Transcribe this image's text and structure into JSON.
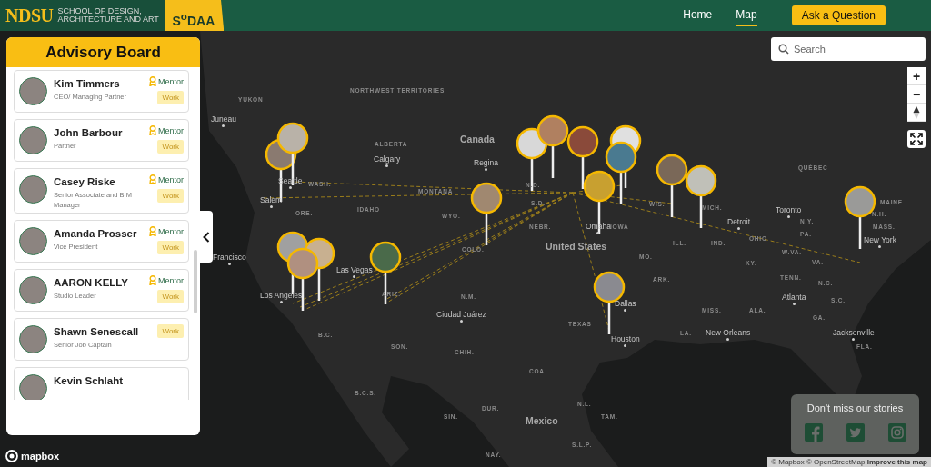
{
  "header": {
    "logo_mark": "NDSU",
    "school_name": "SCHOOL OF DESIGN, ARCHITECTURE AND ART",
    "badge": "S$^{o}$DAA",
    "nav": [
      {
        "label": "Home",
        "selected": false
      },
      {
        "label": "Map",
        "selected": true
      }
    ],
    "cta": "Ask a Question"
  },
  "panel": {
    "title": "Advisory Board",
    "members": [
      {
        "name": "Kim Timmers",
        "role": "CEO/ Managing Partner",
        "mentor": true,
        "mentor_label": "Mentor",
        "tag": "Work"
      },
      {
        "name": "John Barbour",
        "role": "Partner",
        "mentor": true,
        "mentor_label": "Mentor",
        "tag": "Work"
      },
      {
        "name": "Casey Riske",
        "role": "Senior Associate and BIM Manager",
        "mentor": true,
        "mentor_label": "Mentor",
        "tag": "Work"
      },
      {
        "name": "Amanda Prosser",
        "role": "Vice President",
        "mentor": true,
        "mentor_label": "Mentor",
        "tag": "Work"
      },
      {
        "name": "AARON KELLY",
        "role": "Studio Leader",
        "mentor": true,
        "mentor_label": "Mentor",
        "tag": "Work"
      },
      {
        "name": "Shawn Senescall",
        "role": "Senior Job Captain",
        "mentor": false,
        "tag": "Work"
      },
      {
        "name": "Kevin Schlaht",
        "mentor": false
      }
    ]
  },
  "search": {
    "placeholder": "Search"
  },
  "zoom_controls": [
    "+",
    "−"
  ],
  "map_labels": [
    {
      "text": "NORTHWEST TERRITORIES",
      "kind": "region"
    },
    {
      "text": "YUKON",
      "kind": "region"
    },
    {
      "text": "Juneau",
      "kind": "city"
    },
    {
      "text": "Canada",
      "kind": "country"
    },
    {
      "text": "ALBERTA",
      "kind": "region"
    },
    {
      "text": "Calgary",
      "kind": "city"
    },
    {
      "text": "Regina",
      "kind": "city"
    },
    {
      "text": "QUÉBEC",
      "kind": "region"
    },
    {
      "text": "Seattle",
      "kind": "city"
    },
    {
      "text": "WASH.",
      "kind": "region"
    },
    {
      "text": "MONTANA",
      "kind": "region"
    },
    {
      "text": "N.D.",
      "kind": "region"
    },
    {
      "text": "Salem",
      "kind": "city"
    },
    {
      "text": "S.D.",
      "kind": "region"
    },
    {
      "text": "IDAHO",
      "kind": "region"
    },
    {
      "text": "ORE.",
      "kind": "region"
    },
    {
      "text": "WYO.",
      "kind": "region"
    },
    {
      "text": "MICH.",
      "kind": "region"
    },
    {
      "text": "Toronto",
      "kind": "city"
    },
    {
      "text": "MAINE",
      "kind": "region"
    },
    {
      "text": "WIS.",
      "kind": "region"
    },
    {
      "text": "Detroit",
      "kind": "city"
    },
    {
      "text": "N.H.",
      "kind": "region"
    },
    {
      "text": "N.Y.",
      "kind": "region"
    },
    {
      "text": "NEBR.",
      "kind": "region"
    },
    {
      "text": "Omaha",
      "kind": "city"
    },
    {
      "text": "IOWA",
      "kind": "region"
    },
    {
      "text": "MASS.",
      "kind": "region"
    },
    {
      "text": "PA.",
      "kind": "region"
    },
    {
      "text": "OHIO",
      "kind": "region"
    },
    {
      "text": "New York",
      "kind": "city"
    },
    {
      "text": "ILL.",
      "kind": "region"
    },
    {
      "text": "IND.",
      "kind": "region"
    },
    {
      "text": "United States",
      "kind": "country"
    },
    {
      "text": "COLO.",
      "kind": "region"
    },
    {
      "text": "Francisco",
      "kind": "city"
    },
    {
      "text": "W.VA.",
      "kind": "region"
    },
    {
      "text": "MO.",
      "kind": "region"
    },
    {
      "text": "KY.",
      "kind": "region"
    },
    {
      "text": "VA.",
      "kind": "region"
    },
    {
      "text": "Las Vegas",
      "kind": "city"
    },
    {
      "text": "TENN.",
      "kind": "region"
    },
    {
      "text": "ARK.",
      "kind": "region"
    },
    {
      "text": "N.C.",
      "kind": "region"
    },
    {
      "text": "Los Angeles",
      "kind": "city"
    },
    {
      "text": "ARIZ.",
      "kind": "region"
    },
    {
      "text": "N.M.",
      "kind": "region"
    },
    {
      "text": "Atlanta",
      "kind": "city"
    },
    {
      "text": "S.C.",
      "kind": "region"
    },
    {
      "text": "Dallas",
      "kind": "city"
    },
    {
      "text": "Ciudad Juárez",
      "kind": "city"
    },
    {
      "text": "MISS.",
      "kind": "region"
    },
    {
      "text": "ALA.",
      "kind": "region"
    },
    {
      "text": "GA.",
      "kind": "region"
    },
    {
      "text": "TEXAS",
      "kind": "region"
    },
    {
      "text": "LA.",
      "kind": "region"
    },
    {
      "text": "New Orleans",
      "kind": "city"
    },
    {
      "text": "Jacksonville",
      "kind": "city"
    },
    {
      "text": "B.C.",
      "kind": "region"
    },
    {
      "text": "Houston",
      "kind": "city"
    },
    {
      "text": "SON.",
      "kind": "region"
    },
    {
      "text": "FLA.",
      "kind": "region"
    },
    {
      "text": "CHIH.",
      "kind": "region"
    },
    {
      "text": "COA.",
      "kind": "region"
    },
    {
      "text": "B.C.S.",
      "kind": "region"
    },
    {
      "text": "N.L.",
      "kind": "region"
    },
    {
      "text": "DUR.",
      "kind": "region"
    },
    {
      "text": "SIN.",
      "kind": "region"
    },
    {
      "text": "TAM.",
      "kind": "region"
    },
    {
      "text": "Mexico",
      "kind": "country"
    },
    {
      "text": "S.L.P.",
      "kind": "region"
    },
    {
      "text": "NAY.",
      "kind": "region"
    }
  ],
  "stories": {
    "title": "Don't miss our stories",
    "links": [
      {
        "kind": "facebook"
      },
      {
        "kind": "twitter"
      },
      {
        "kind": "instagram"
      }
    ]
  },
  "mapbox_logo": "mapbox",
  "attribution": "© Mapbox © OpenStreetMap **Improve this map**"
}
